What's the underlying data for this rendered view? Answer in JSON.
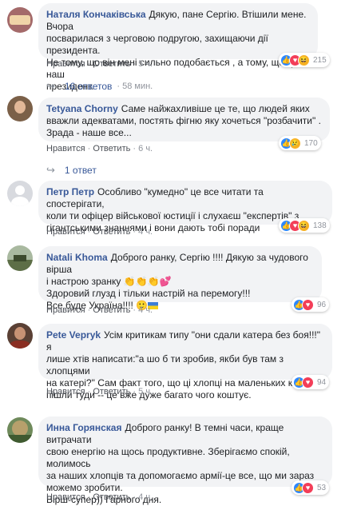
{
  "comments": [
    {
      "author": "Наталя Кончаківська",
      "lines": [
        "Дякую, пане Сергію. Втішили мене. Вчора",
        "посварилася з черговою подругою, захищаючи дії президента.",
        "Не тому, що він мені сильно подобається , а тому, що це наш",
        "президент."
      ],
      "like": "Нравится",
      "reply": "Ответить",
      "time": "5 ч.",
      "reactions": "215",
      "replies": "16 ответов",
      "replies_time": "58 мин."
    },
    {
      "author": "Tetyana Chorny",
      "lines": [
        "Саме найжахливіше це те, що людей яких",
        "вважли адекватами, постять фігню яку хочеться \"розбачити\" .",
        "Зрада - наше все..."
      ],
      "like": "Нравится",
      "reply": "Ответить",
      "time": "6 ч.",
      "reactions": "170",
      "replies": "1 ответ"
    },
    {
      "author": "Петр Петр",
      "lines": [
        "Особливо \"кумедно\" це все читати та спостерігати,",
        "коли ти офіцер військової юстиції і слухаєш \"експертів\" з",
        "гігантськими знаннями і вони дають тобі поради"
      ],
      "like": "Нравится",
      "reply": "Ответить",
      "time": "4 ч.",
      "reactions": "138"
    },
    {
      "author": "Natali Khoma",
      "lines": [
        "Доброго ранку, Сергію !!!! Дякую за чудового вірша",
        "і настрою зранку",
        "Здоровий глузд і тільки настрій на перемогу!!!",
        "Все буде Україна!!!!"
      ],
      "like": "Нравится",
      "reply": "Ответить",
      "time": "4 ч.",
      "reactions": "96"
    },
    {
      "author": "Pete Vepryk",
      "lines": [
        "Усім критикам типу \"они сдали катера без боя!!!\" я",
        "лише хтів написати:\"а шо б ти зробив, якби був там з хлопцями",
        "на катері?\" Сам факт того, що ці хлопці на маленьких катерах",
        "пішли туди -- це вже дуже багато чого коштує."
      ],
      "like": "Нравится",
      "reply": "Ответить",
      "time": "5 ч.",
      "reactions": "94"
    },
    {
      "author": "Инна Горянская",
      "lines": [
        "Доброго ранку! В темні часи, краще витрачати",
        "свою енергію на щось продуктивне. Зберігаємо спокій, молимось",
        "за наших хлопців та допомогаємо армії-це все, що ми зараз",
        "можемо зробити.",
        "Вірш-супер)) Гарного дня."
      ],
      "like": "Нравится",
      "reply": "Ответить",
      "time": "4 ч.",
      "reactions": "53"
    }
  ],
  "colors": {
    "link": "#385898",
    "bubble": "#f2f3f5",
    "meta": "#90949c"
  }
}
